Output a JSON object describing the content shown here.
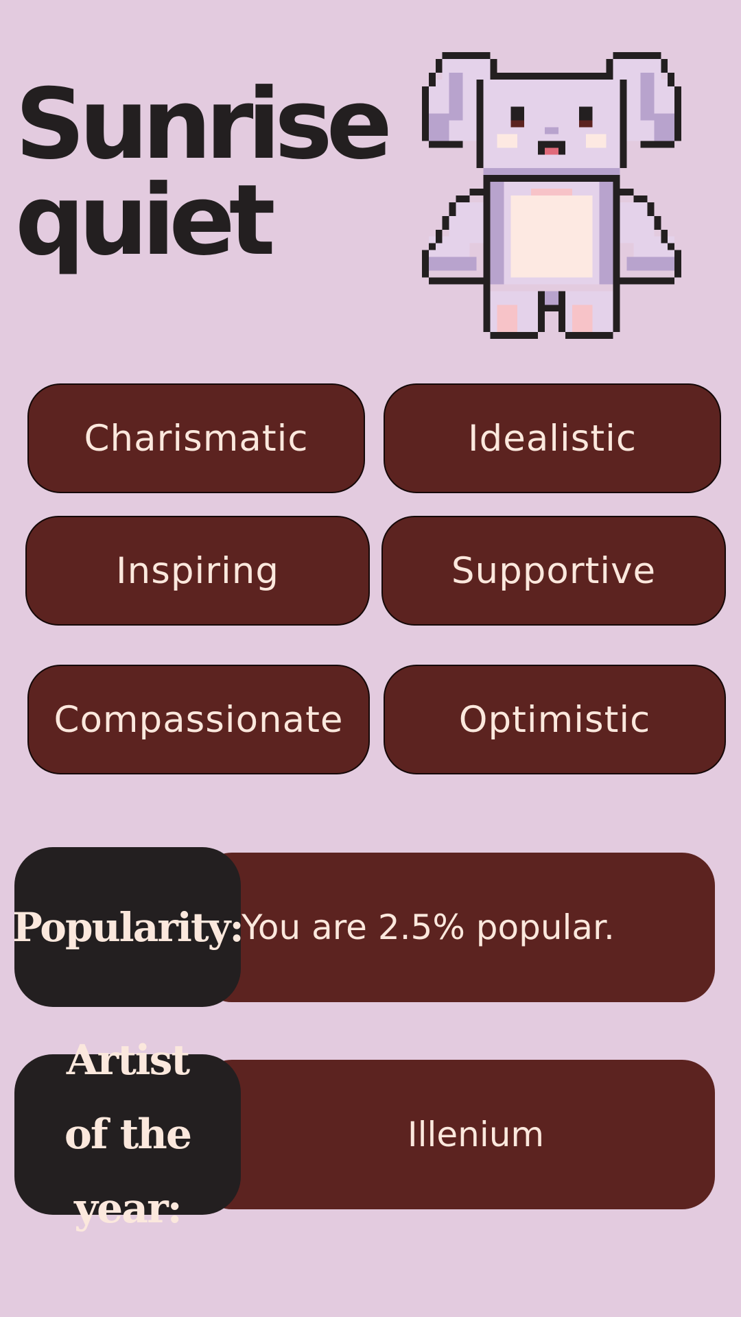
{
  "title": {
    "line1": "Sunrise",
    "line2": "quiet"
  },
  "mascot": {
    "icon": "pixel-bunny-icon"
  },
  "traits": [
    "Charismatic",
    "Idealistic",
    "Inspiring",
    "Supportive",
    "Compassionate",
    "Optimistic"
  ],
  "popularity": {
    "label": "Popularity:",
    "value": "You are 2.5% popular."
  },
  "artist": {
    "label": "Artist of the year:",
    "value": "Illenium"
  },
  "colors": {
    "background": "#e3cbdf",
    "pill": "#5c2320",
    "label_bg": "#231f20",
    "pill_text": "#fbe8dd",
    "title_text": "#231f20",
    "bunny_fur": "#e4d2ea",
    "bunny_shade": "#b8a3cd",
    "bunny_belly": "#fde9e2",
    "bunny_pink": "#f7c3c8"
  }
}
